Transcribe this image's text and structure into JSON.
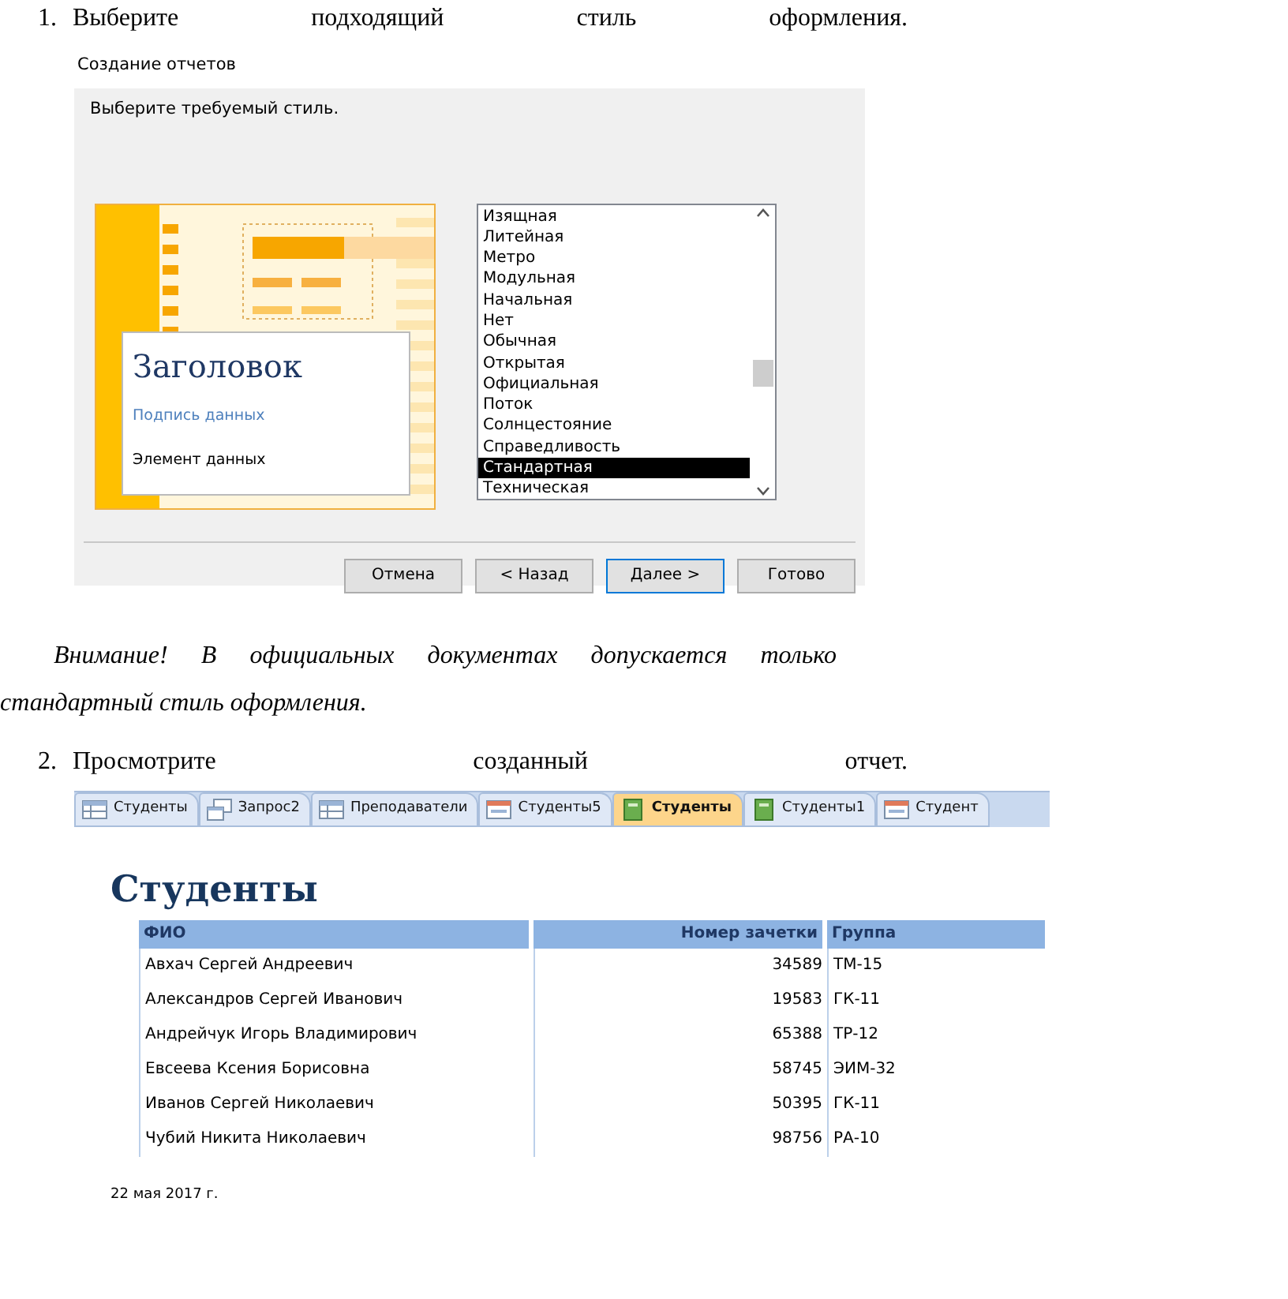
{
  "blocks": [
    {
      "kind": "step",
      "number": "1.",
      "text": "Выберите подходящий стиль оформления."
    },
    {
      "kind": "dialog",
      "title": "Создание отчетов",
      "prompt": "Выберите требуемый стиль.",
      "preview": {
        "heading": "Заголовок",
        "caption": "Подпись данных",
        "item": "Элемент данных"
      },
      "styles": [
        {
          "label": "Изящная",
          "selected": false
        },
        {
          "label": "Литейная",
          "selected": false
        },
        {
          "label": "Метро",
          "selected": false
        },
        {
          "label": "Модульная",
          "selected": false
        },
        {
          "label": "Начальная",
          "selected": false
        },
        {
          "label": "Нет",
          "selected": false
        },
        {
          "label": "Обычная",
          "selected": false
        },
        {
          "label": "Открытая",
          "selected": false
        },
        {
          "label": "Официальная",
          "selected": false
        },
        {
          "label": "Поток",
          "selected": false
        },
        {
          "label": "Солнцестояние",
          "selected": false
        },
        {
          "label": "Справедливость",
          "selected": false
        },
        {
          "label": "Стандартная",
          "selected": true
        },
        {
          "label": "Техническая",
          "selected": false
        }
      ],
      "buttons": [
        {
          "label": "Отмена",
          "default": false
        },
        {
          "label": "< Назад",
          "default": false
        },
        {
          "label": "Далее >",
          "default": true
        },
        {
          "label": "Готово",
          "default": false
        }
      ]
    },
    {
      "kind": "note",
      "text": "*Внимание! В официальных документах допускается только стандартный стиль оформления.*"
    },
    {
      "kind": "step",
      "number": "2.",
      "text": "Просмотрите созданный отчет."
    },
    {
      "kind": "tabs",
      "tabs": [
        {
          "label": "Студенты",
          "kind": "table",
          "selected": false
        },
        {
          "label": "Запрос2",
          "kind": "query",
          "selected": false
        },
        {
          "label": "Преподаватели",
          "kind": "table",
          "selected": false
        },
        {
          "label": "Студенты5",
          "kind": "form",
          "selected": false
        },
        {
          "label": "Студенты",
          "kind": "report",
          "selected": true
        },
        {
          "label": "Студенты1",
          "kind": "report",
          "selected": false
        },
        {
          "label": "Студент",
          "kind": "form",
          "selected": false
        }
      ]
    },
    {
      "kind": "report",
      "title": "Студенты",
      "columns": [
        "ФИО",
        "Номер зачетки",
        "Группа"
      ],
      "rows": [
        [
          "Авхач Сергей Андреевич",
          "34589",
          "ТМ-15"
        ],
        [
          "Александров Сергей Иванович",
          "19583",
          "ГК-11"
        ],
        [
          "Андрейчук Игорь Владимирович",
          "65388",
          "ТР-12"
        ],
        [
          "Евсеева Ксения Борисовна",
          "58745",
          "ЭИМ-32"
        ],
        [
          "Иванов Сергей Николаевич",
          "50395",
          "ГК-11"
        ],
        [
          "Чубий Никита Николаевич",
          "98756",
          "РА-10"
        ]
      ],
      "date": "22 мая 2017 г."
    }
  ]
}
